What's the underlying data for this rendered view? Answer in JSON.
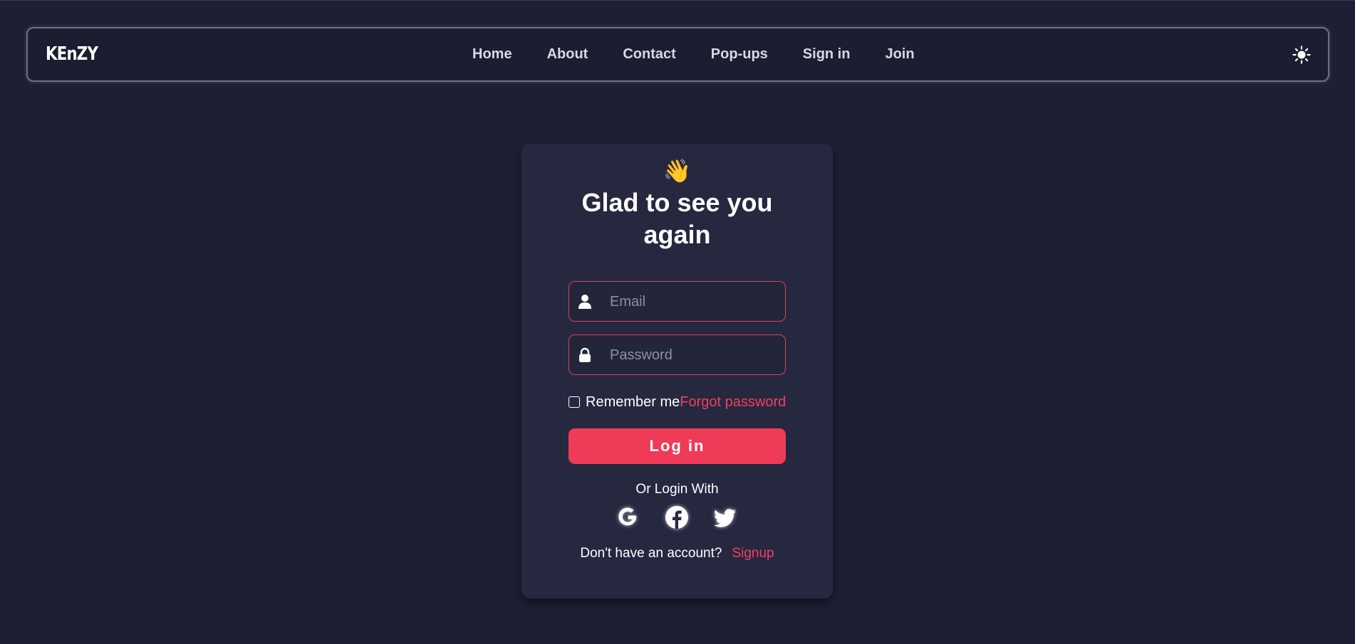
{
  "nav": {
    "brand": "KEnZY",
    "links": [
      "Home",
      "About",
      "Contact",
      "Pop-ups",
      "Sign in",
      "Join"
    ],
    "theme_icon": "sun-icon"
  },
  "login": {
    "emoji": "👋",
    "title": "Glad to see you again",
    "email_placeholder": "Email",
    "email_icon": "user-icon",
    "password_placeholder": "Password",
    "password_icon": "lock-icon",
    "remember_label": "Remember me",
    "forgot_label": "Forgot password",
    "login_button": "Log in",
    "or_text": "Or Login With",
    "socials": [
      "google-icon",
      "facebook-icon",
      "twitter-icon"
    ],
    "no_account_text": "Don't have an account?",
    "signup_label": "Signup"
  },
  "colors": {
    "background": "#1d1f33",
    "card": "#262840",
    "accent": "#ef3b58"
  }
}
